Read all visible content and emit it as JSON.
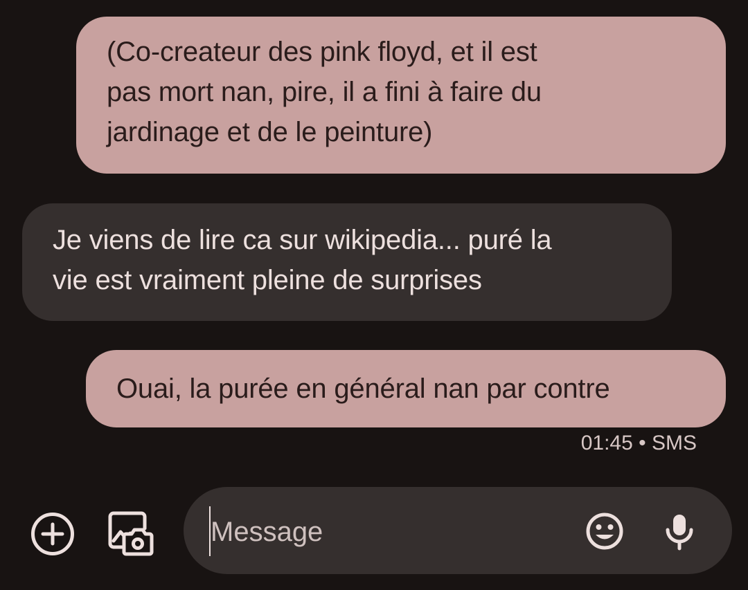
{
  "conversation": {
    "messages": [
      {
        "direction": "outgoing",
        "text": "(Co-createur des pink floyd, et il est\npas mort nan, pire, il a fini à faire du\njardinage et de le peinture)"
      },
      {
        "direction": "incoming",
        "text": "Je viens de lire ca sur wikipedia... puré la\nvie est vraiment pleine de surprises"
      },
      {
        "direction": "outgoing",
        "text": "Ouai, la purée en général nan par contre"
      }
    ],
    "last_message_meta": {
      "time": "01:45",
      "separator": "•",
      "channel": "SMS"
    }
  },
  "composer": {
    "placeholder": "Message",
    "value": "",
    "icons": {
      "add": "add-circle-icon",
      "media": "gallery-camera-icon",
      "emoji": "emoji-icon",
      "voice": "microphone-icon"
    }
  },
  "theme": {
    "background": "#181312",
    "outgoing_bubble": "#c8a19f",
    "incoming_bubble": "#352f2e",
    "text_light": "#ede0de",
    "text_dark": "#2a1c1b"
  }
}
